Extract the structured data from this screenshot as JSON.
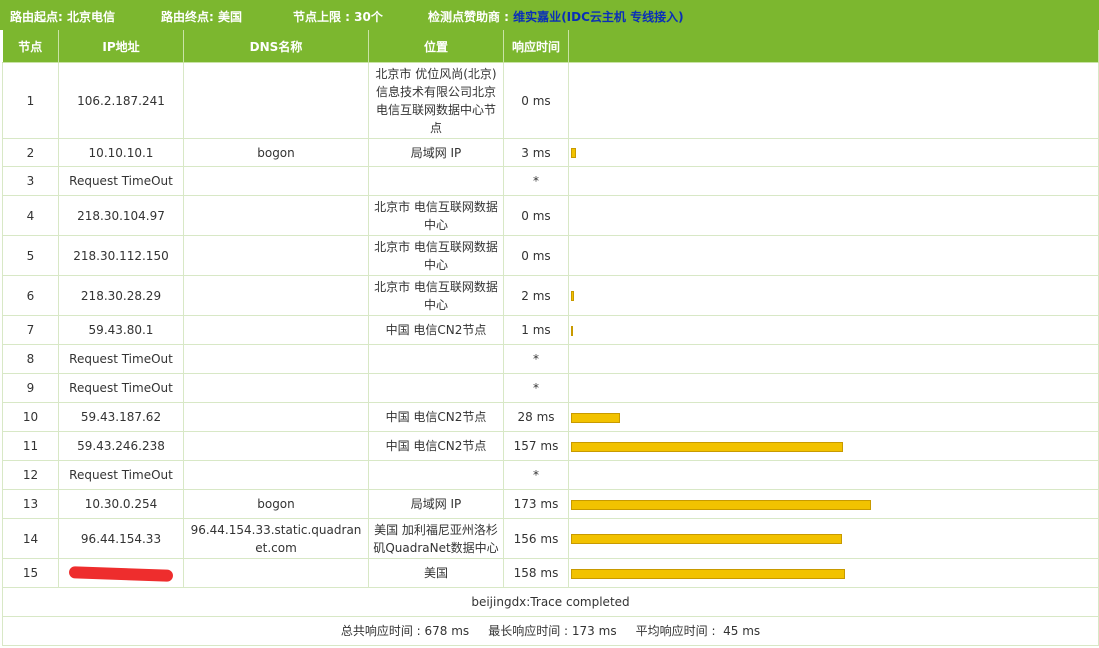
{
  "topbar": {
    "origin": "路由起点: 北京电信",
    "dest": "路由终点: 美国",
    "limit": "节点上限 : 30个",
    "sponsor_label": "检测点赞助商 :",
    "sponsor1": "维实嘉业",
    "paren_open": "(",
    "sponsor2": "IDC云主机",
    "sponsor3": "专线接入",
    "paren_close": ")"
  },
  "headers": [
    "节点",
    "IP地址",
    "DNS名称",
    "位置",
    "响应时间",
    ""
  ],
  "rows": [
    {
      "node": "1",
      "ip": "106.2.187.241",
      "dns": "",
      "loc": "北京市 优位风尚(北京)信息技术有限公司北京电信互联网数据中心节点",
      "time": "0 ms",
      "ms": 0
    },
    {
      "node": "2",
      "ip": "10.10.10.1",
      "dns": "bogon",
      "loc": "局域网 IP",
      "time": "3 ms",
      "ms": 3
    },
    {
      "node": "3",
      "ip": "Request TimeOut",
      "dns": "",
      "loc": "",
      "time": "*",
      "ms": 0
    },
    {
      "node": "4",
      "ip": "218.30.104.97",
      "dns": "",
      "loc": "北京市 电信互联网数据中心",
      "time": "0 ms",
      "ms": 0
    },
    {
      "node": "5",
      "ip": "218.30.112.150",
      "dns": "",
      "loc": "北京市 电信互联网数据中心",
      "time": "0 ms",
      "ms": 0
    },
    {
      "node": "6",
      "ip": "218.30.28.29",
      "dns": "",
      "loc": "北京市 电信互联网数据中心",
      "time": "2 ms",
      "ms": 2
    },
    {
      "node": "7",
      "ip": "59.43.80.1",
      "dns": "",
      "loc": "中国 电信CN2节点",
      "time": "1 ms",
      "ms": 1
    },
    {
      "node": "8",
      "ip": "Request TimeOut",
      "dns": "",
      "loc": "",
      "time": "*",
      "ms": 0
    },
    {
      "node": "9",
      "ip": "Request TimeOut",
      "dns": "",
      "loc": "",
      "time": "*",
      "ms": 0
    },
    {
      "node": "10",
      "ip": "59.43.187.62",
      "dns": "",
      "loc": "中国 电信CN2节点",
      "time": "28 ms",
      "ms": 28
    },
    {
      "node": "11",
      "ip": "59.43.246.238",
      "dns": "",
      "loc": "中国 电信CN2节点",
      "time": "157 ms",
      "ms": 157
    },
    {
      "node": "12",
      "ip": "Request TimeOut",
      "dns": "",
      "loc": "",
      "time": "*",
      "ms": 0
    },
    {
      "node": "13",
      "ip": "10.30.0.254",
      "dns": "bogon",
      "loc": "局域网 IP",
      "time": "173 ms",
      "ms": 173
    },
    {
      "node": "14",
      "ip": "96.44.154.33",
      "dns": "96.44.154.33.static.quadranet.com",
      "loc": "美国 加利福尼亚州洛杉矶QuadraNet数据中心",
      "time": "156 ms",
      "ms": 156
    },
    {
      "node": "15",
      "ip": "",
      "redacted": true,
      "dns": "",
      "loc": "美国",
      "time": "158 ms",
      "ms": 158
    }
  ],
  "max_ms": 173,
  "footer": {
    "status": "beijingdx:Trace completed",
    "summary": "总共响应时间 : 678 ms     最长响应时间 : 173 ms     平均响应时间 :  45 ms"
  }
}
